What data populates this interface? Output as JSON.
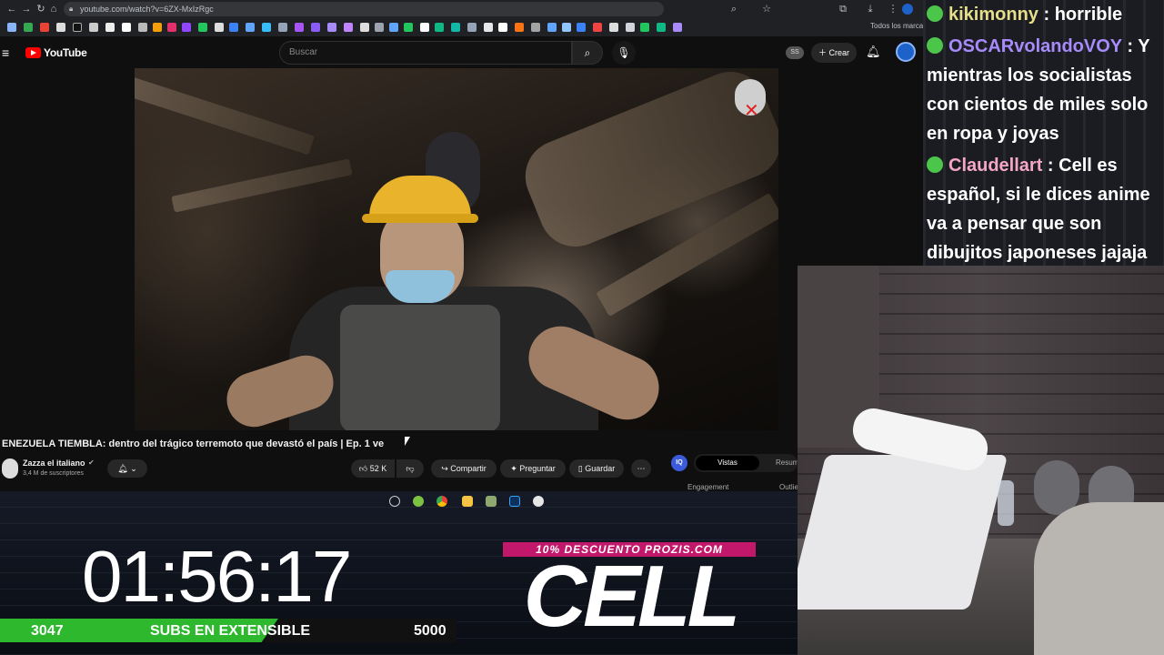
{
  "browser": {
    "url": "youtube.com/watch?v=6ZX-MxIzRgc",
    "bookmarks_all": "Todos los marcador"
  },
  "youtube": {
    "logo_text": "YouTube",
    "search_placeholder": "Buscar",
    "ss_badge": "SS",
    "create_label": "Crear",
    "video_title": "ENEZUELA TIEMBLA: dentro del trágico terremoto que devastó el país | Ep. 1 ve",
    "channel_name": "Zazza el italiano",
    "channel_subs": "3,4 M de suscriptores",
    "like_count": "52 K",
    "share_label": "Compartir",
    "ask_label": "Preguntar",
    "save_label": "Guardar"
  },
  "vidiq": {
    "badge": "IQ",
    "tab_active": "Vistas",
    "tab_other": "Resum",
    "engagement": "Engagement",
    "outliers": "Outlie"
  },
  "overlay": {
    "timer": "01:56:17",
    "subs_current": "3047",
    "subs_label": "SUBS EN EXTENSIBLE",
    "subs_goal": "5000",
    "subs_progress": 0.6094,
    "promo": "10% DESCUENTO PROZIS.COM",
    "logo": "CELL"
  },
  "chat": {
    "messages": [
      {
        "user": "kikimonny",
        "user_color": "#e6df8a",
        "text": " : horrible"
      },
      {
        "user": "OSCARvolandoVOY",
        "user_color": "#a78bfa",
        "text": " : Y mientras los socialistas con cientos de miles solo en ropa y joyas"
      },
      {
        "user": "Claudellart",
        "user_color": "#f3a6c6",
        "text": " : Cell es español, si le dices anime va a pensar que son dibujitos japoneses jajaja"
      }
    ]
  }
}
